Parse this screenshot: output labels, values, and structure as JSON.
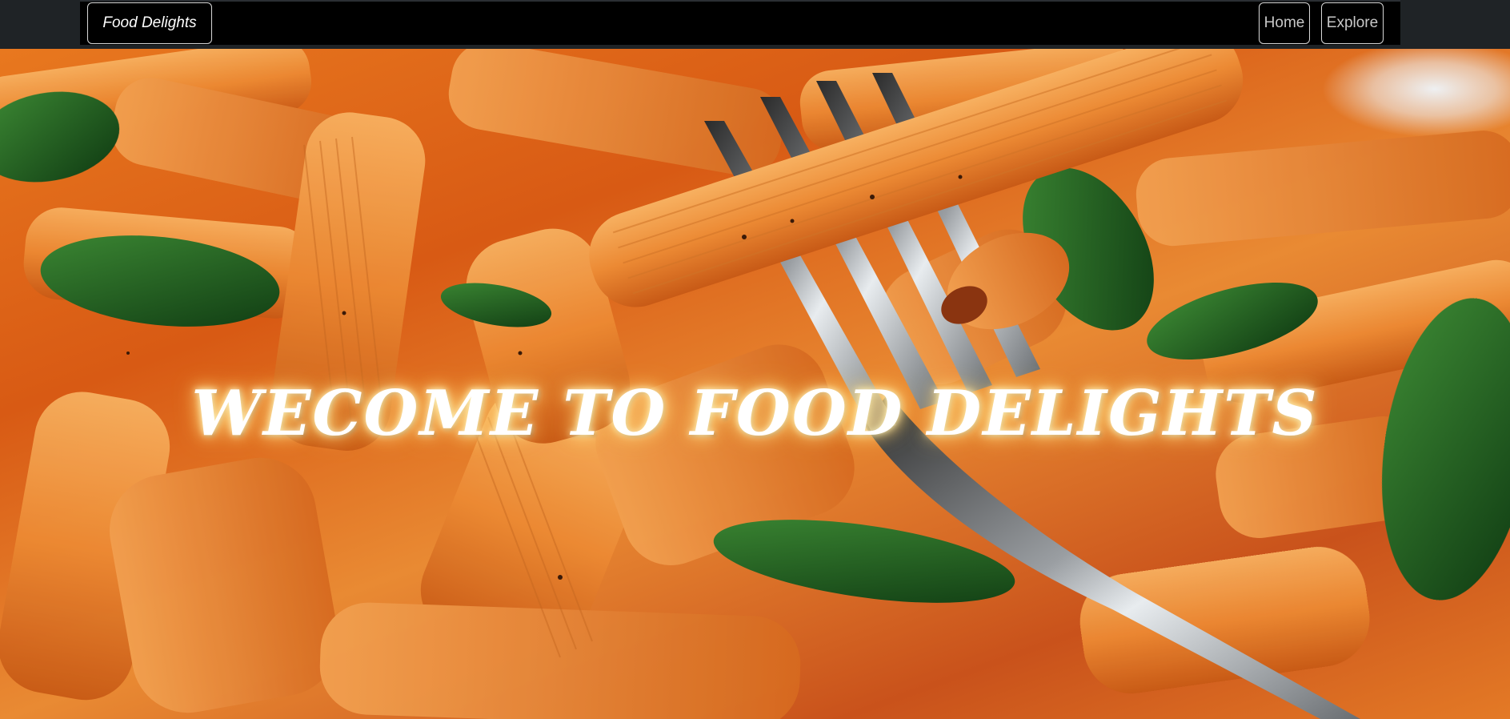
{
  "navbar": {
    "brand": "Food Delights",
    "links": [
      {
        "label": "Home"
      },
      {
        "label": "Explore"
      }
    ]
  },
  "hero": {
    "title": "WECOME TO FOOD DELIGHTS",
    "image_subject": "penne pasta with tomato cream sauce, spinach and a fork"
  },
  "colors": {
    "navbar_bg": "#000000",
    "topbar_bg": "#1f2326",
    "brand_text": "#ffffff",
    "link_text": "#c8c8c8",
    "sauce": "#e06a1c",
    "spinach": "#1f5a1f"
  }
}
